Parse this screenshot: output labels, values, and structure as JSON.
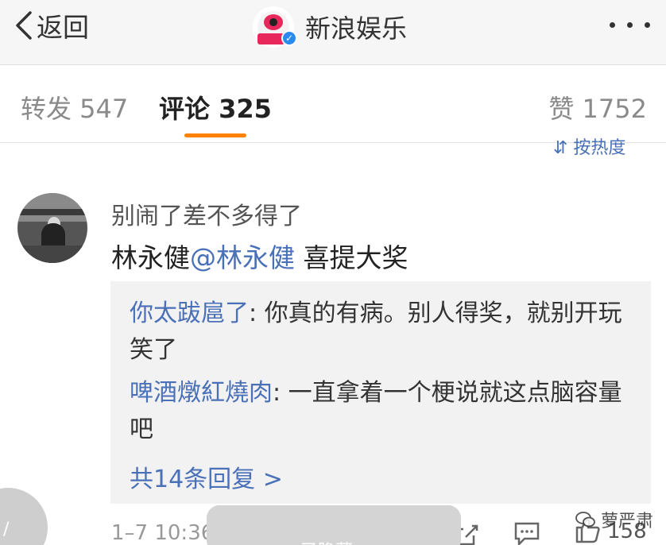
{
  "topbar": {
    "back_label": "返回",
    "title": "新浪娱乐",
    "verified_icon": "verified-badge-icon",
    "more_icon": "more-dots-icon"
  },
  "tabs": {
    "repost": "转发 547",
    "comment": "评论 325",
    "like": "赞 1752",
    "active": "comment",
    "active_color": "#ff8200"
  },
  "sort_label": "⇵ 按热度",
  "comment": {
    "user": "别闹了差不多得了",
    "text_before": "林永健",
    "mention": "@林永健",
    "text_after": " 喜提大奖",
    "replies": [
      {
        "user": "你太跋扈了",
        "text": ": 你真的有病。别人得奖，就别开玩笑了"
      },
      {
        "user": "啤酒燉紅燒肉",
        "text": ": 一直拿着一个梗说就这点脑容量吧"
      }
    ],
    "total_replies": "共14条回复 >",
    "time": "1–7 10:36",
    "like_count": "158"
  },
  "overlay": {
    "pill_label": "已隐藏",
    "watermark": "萝严肃"
  },
  "colors": {
    "link": "#4a70b8",
    "accent": "#ff8200",
    "reply_bg": "#f2f2f2"
  }
}
